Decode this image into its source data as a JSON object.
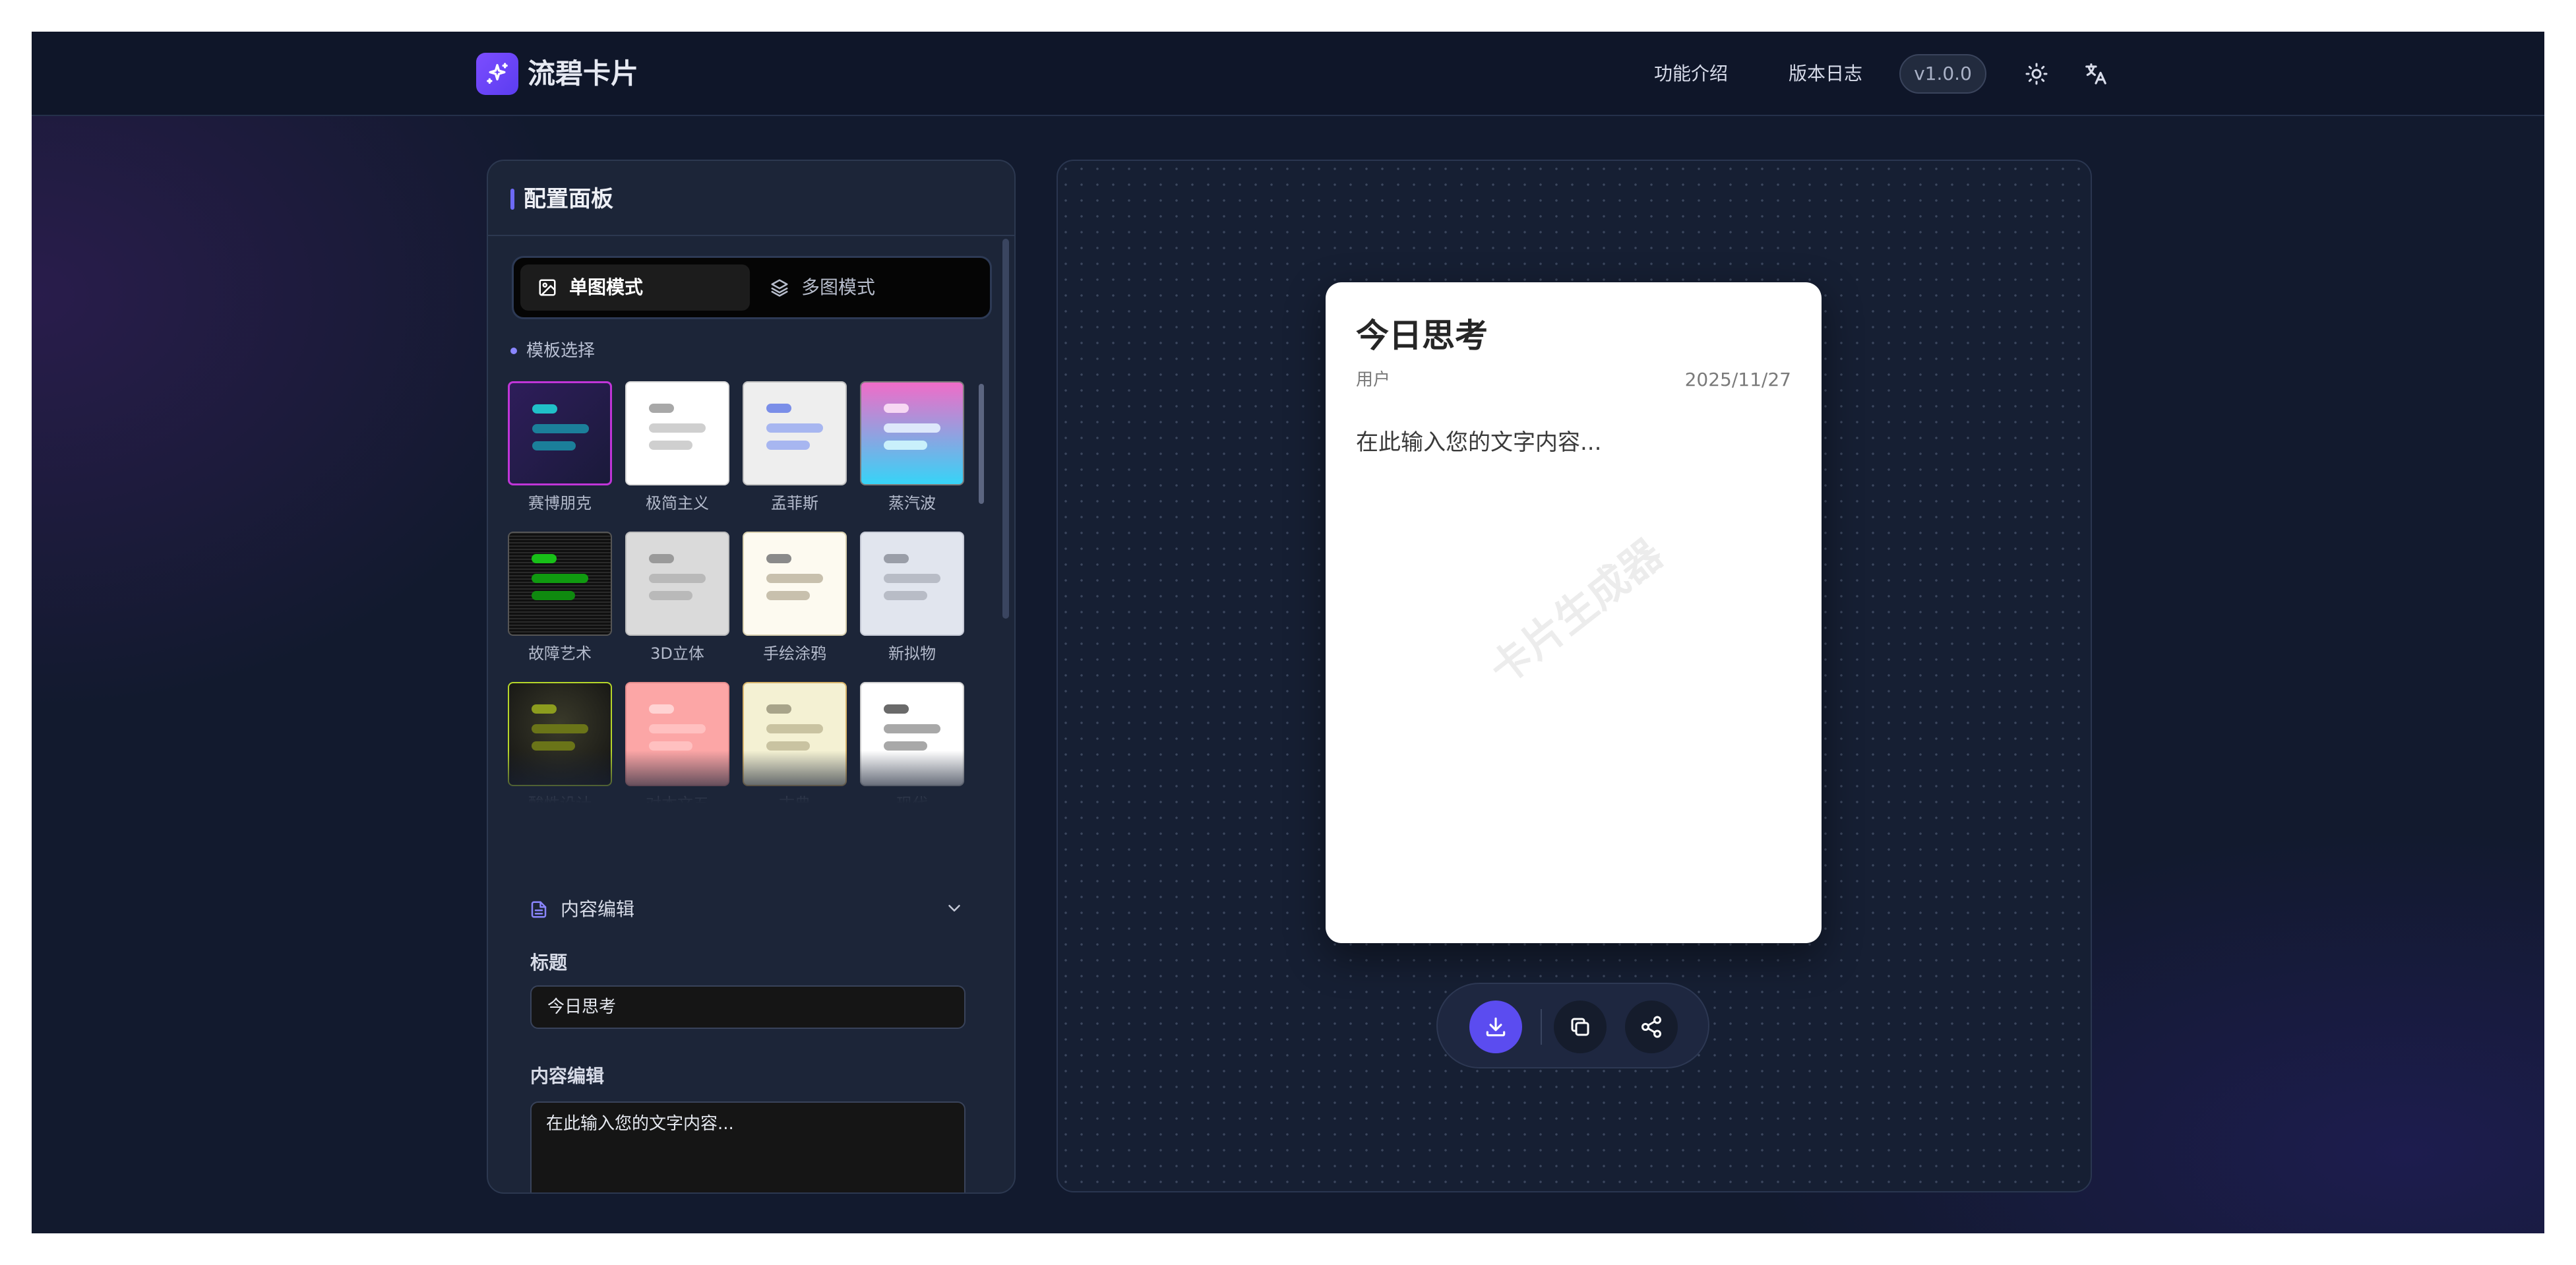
{
  "header": {
    "app_name": "流碧卡片",
    "nav": [
      "功能介绍",
      "版本日志"
    ],
    "version": "v1.0.0"
  },
  "panel": {
    "title": "配置面板",
    "modes": [
      "单图模式",
      "多图模式"
    ],
    "active_mode": "单图模式",
    "template_section_label": "模板选择",
    "templates": [
      {
        "label": "赛博朋克",
        "bg": "linear-gradient(135deg,#2e1d5a,#1a1a3a)",
        "border": "#c035d8",
        "l1": "#20c0c8",
        "l2": "#1b7f9a",
        "l3": "#1b7f9a",
        "selected": true
      },
      {
        "label": "极简主义",
        "bg": "#ffffff",
        "border": "#d8d8d8",
        "l1": "#a8a8a8",
        "l2": "#cfcfcf",
        "l3": "#cfcfcf"
      },
      {
        "label": "孟菲斯",
        "bg": "#eeeeee",
        "border": "#bfbfbf",
        "l1": "#7a8ee8",
        "l2": "#a7b6f0",
        "l3": "#a7b6f0"
      },
      {
        "label": "蒸汽波",
        "bg": "linear-gradient(180deg,#f06cc8,#36d4f7)",
        "border": "#7a7a7a",
        "l1": "#f7d7f3",
        "l2": "#dde8fb",
        "l3": "#c9f0fb"
      },
      {
        "label": "故障艺术",
        "bg": "repeating-linear-gradient(0deg,#101010 0px,#101010 3px,#2a2a2a 3px,#2a2a2a 5px)",
        "border": "#555555",
        "l1": "#18c018",
        "l2": "#109a10",
        "l3": "#0f8a0f"
      },
      {
        "label": "3D立体",
        "bg": "#dadada",
        "border": "#bbbbbb",
        "l1": "#9a9a9a",
        "l2": "#b9b9b9",
        "l3": "#b9b9b9"
      },
      {
        "label": "手绘涂鸦",
        "bg": "#fdfaf0",
        "border": "#d8cfae",
        "l1": "#8a8a8a",
        "l2": "#c8c0ad",
        "l3": "#c8c0ad"
      },
      {
        "label": "新拟物",
        "bg": "#e1e5ee",
        "border": "#c6cad6",
        "l1": "#9a9ea8",
        "l2": "#b8bcc6",
        "l3": "#b8bcc6"
      },
      {
        "label": "酸性设计",
        "bg": "radial-gradient(circle at 50% 40%,#3a3a2a,#111111)",
        "border": "#b6d62a",
        "l1": "#8c9c1e",
        "l2": "#6a7418",
        "l3": "#6a7418"
      },
      {
        "label": "对本文五",
        "bg": "#fca6a6",
        "border": "#e48c8c",
        "l1": "#ffd3d3",
        "l2": "#ffc0c0",
        "l3": "#ffc0c0"
      },
      {
        "label": "古典",
        "bg": "#f4f1d3",
        "border": "#d8b46a",
        "l1": "#a8a48a",
        "l2": "#c9c3a1",
        "l3": "#c9c3a1"
      },
      {
        "label": "现代",
        "bg": "#ffffff",
        "border": "#d0d0d0",
        "l1": "#6a6a6a",
        "l2": "#a8a8a8",
        "l3": "#a8a8a8"
      }
    ],
    "content_section_label": "内容编辑",
    "title_label": "标题",
    "title_value": "今日思考",
    "content_label": "内容编辑",
    "content_value": "在此输入您的文字内容..."
  },
  "card": {
    "title": "今日思考",
    "author": "用户",
    "date": "2025/11/27",
    "body": "在此输入您的文字内容...",
    "watermark": "卡片生成器"
  },
  "colors": {
    "accent": "#5b4cf0",
    "background": "#121a2e",
    "panel": "#1c2538"
  },
  "icons": {
    "logo": "sparkle-icon",
    "theme": "sun-icon",
    "language": "translate-icon",
    "single_mode": "image-icon",
    "multi_mode": "layers-icon",
    "content": "document-icon",
    "collapse": "chevron-down-icon",
    "download": "download-icon",
    "copy": "copy-icon",
    "share": "share-icon"
  }
}
